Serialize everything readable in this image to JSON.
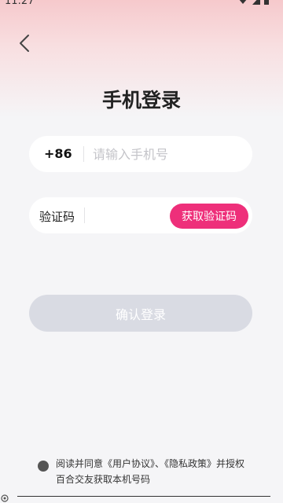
{
  "status_bar": {
    "time": "11:27"
  },
  "header": {
    "title": "手机登录"
  },
  "phone_field": {
    "prefix": "+86",
    "placeholder": "请输入手机号",
    "value": ""
  },
  "code_field": {
    "label": "验证码",
    "value": "",
    "get_code_label": "获取验证码"
  },
  "submit": {
    "label": "确认登录"
  },
  "agreement": {
    "text": "阅读并同意《用户协议》、《隐私政策》并授权百合交友获取本机号码"
  },
  "colors": {
    "accent": "#ee2f7a",
    "submit_disabled": "#d9dbe3",
    "header_gradient": "#f6c9cc"
  }
}
